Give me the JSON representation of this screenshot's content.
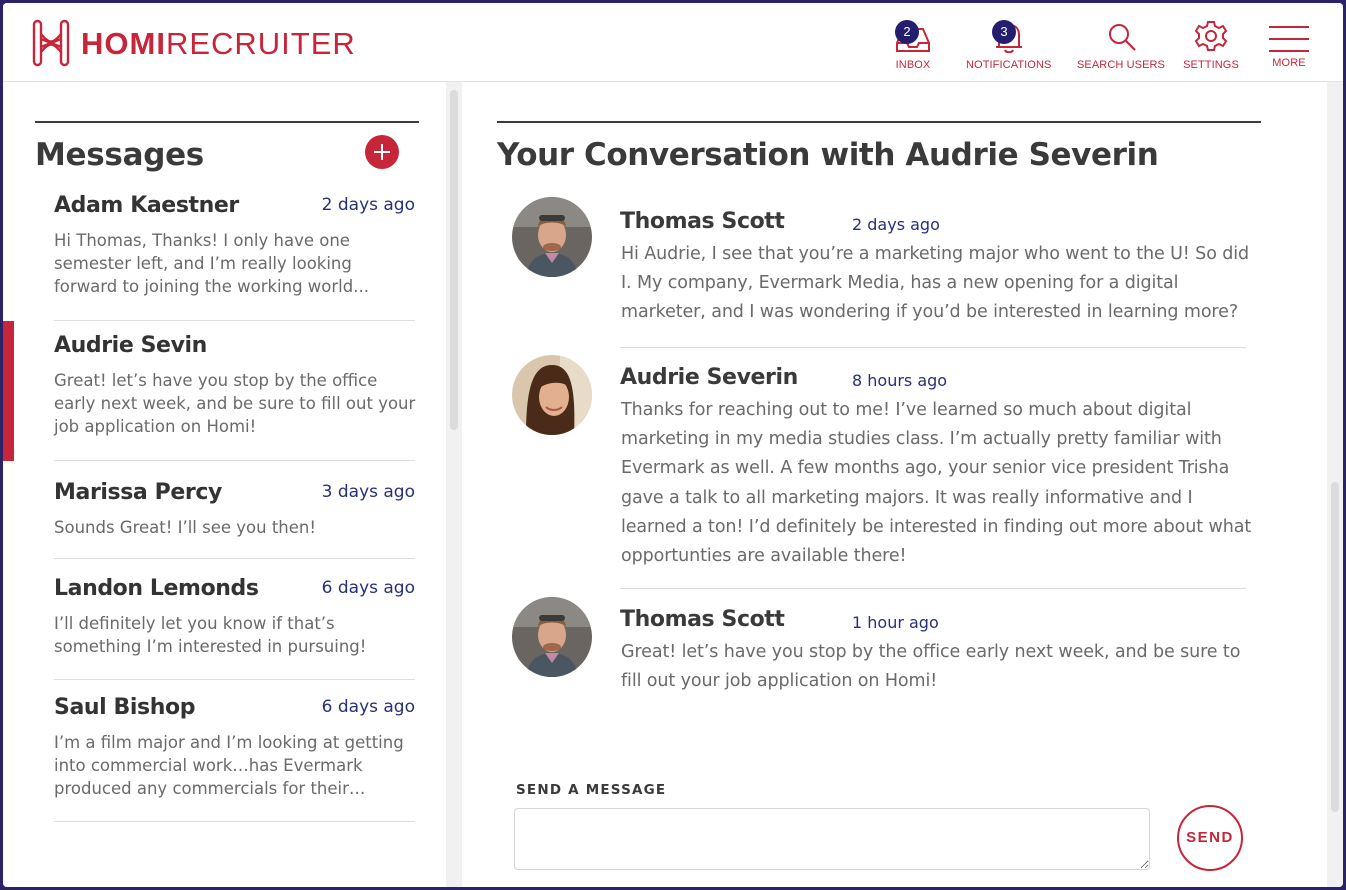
{
  "brand": {
    "bold": "HOMI",
    "light": "RECRUITER",
    "color": "#c7263a"
  },
  "nav": {
    "inbox": {
      "label": "INBOX",
      "badge": "2",
      "icon": "inbox-icon"
    },
    "notifications": {
      "label": "NOTIFICATIONS",
      "badge": "3",
      "icon": "bell-icon"
    },
    "search_users": {
      "label": "SEARCH USERS",
      "icon": "search-icon"
    },
    "settings": {
      "label": "SETTINGS",
      "icon": "gear-icon"
    },
    "more": {
      "label": "MORE",
      "icon": "hamburger-icon"
    }
  },
  "sidebar": {
    "title": "Messages",
    "threads": [
      {
        "name": "Adam Kaestner",
        "time": "2 days ago",
        "preview": "Hi Thomas, Thanks! I only have one semester left, and I’m really looking forward to joining the working world..."
      },
      {
        "name": "Audrie Sevin",
        "time": "",
        "preview": "Great! let’s have you stop by the  office early next week, and be sure to fill out your job application on Homi!",
        "active": true
      },
      {
        "name": "Marissa Percy",
        "time": "3 days ago",
        "preview": "Sounds Great! I’ll see you then!"
      },
      {
        "name": "Landon Lemonds",
        "time": "6 days ago",
        "preview": "I’ll definitely let you know if that’s something I’m interested in pursuing!"
      },
      {
        "name": "Saul Bishop",
        "time": "6 days ago",
        "preview": "I’m a film major and I’m looking at getting into commercial work…has Evermark produced any commercials for their…"
      }
    ]
  },
  "conversation": {
    "title": "Your Conversation with Audrie Severin",
    "messages": [
      {
        "author": "Thomas Scott",
        "time": "2 days ago",
        "body": "Hi Audrie, I see that you’re a marketing major who went to the U! So did I. My company,  Evermark Media, has a new opening for a digital marketer, and I was wondering if you’d be interested in learning more?"
      },
      {
        "author": "Audrie Severin",
        "time": "8 hours ago",
        "body": "Thanks for reaching out to me! I’ve learned so much about digital marketing in my media studies class. I’m actually pretty familiar with Evermark as well. A few months ago, your senior vice president Trisha gave a talk to all marketing majors. It was really informative and I learned a ton! I’d definitely be interested in finding out more about what opportunties are available there!"
      },
      {
        "author": "Thomas Scott",
        "time": "1 hour ago",
        "body": "Great! let’s have you stop by the  office early next week, and be sure to fill out your job application on Homi!"
      }
    ]
  },
  "composer": {
    "label": "SEND A MESSAGE",
    "placeholder": "",
    "send_label": "SEND"
  },
  "colors": {
    "accent": "#c7263a",
    "link": "#27307a",
    "badge": "#241e6e",
    "frame": "#2a2368"
  }
}
